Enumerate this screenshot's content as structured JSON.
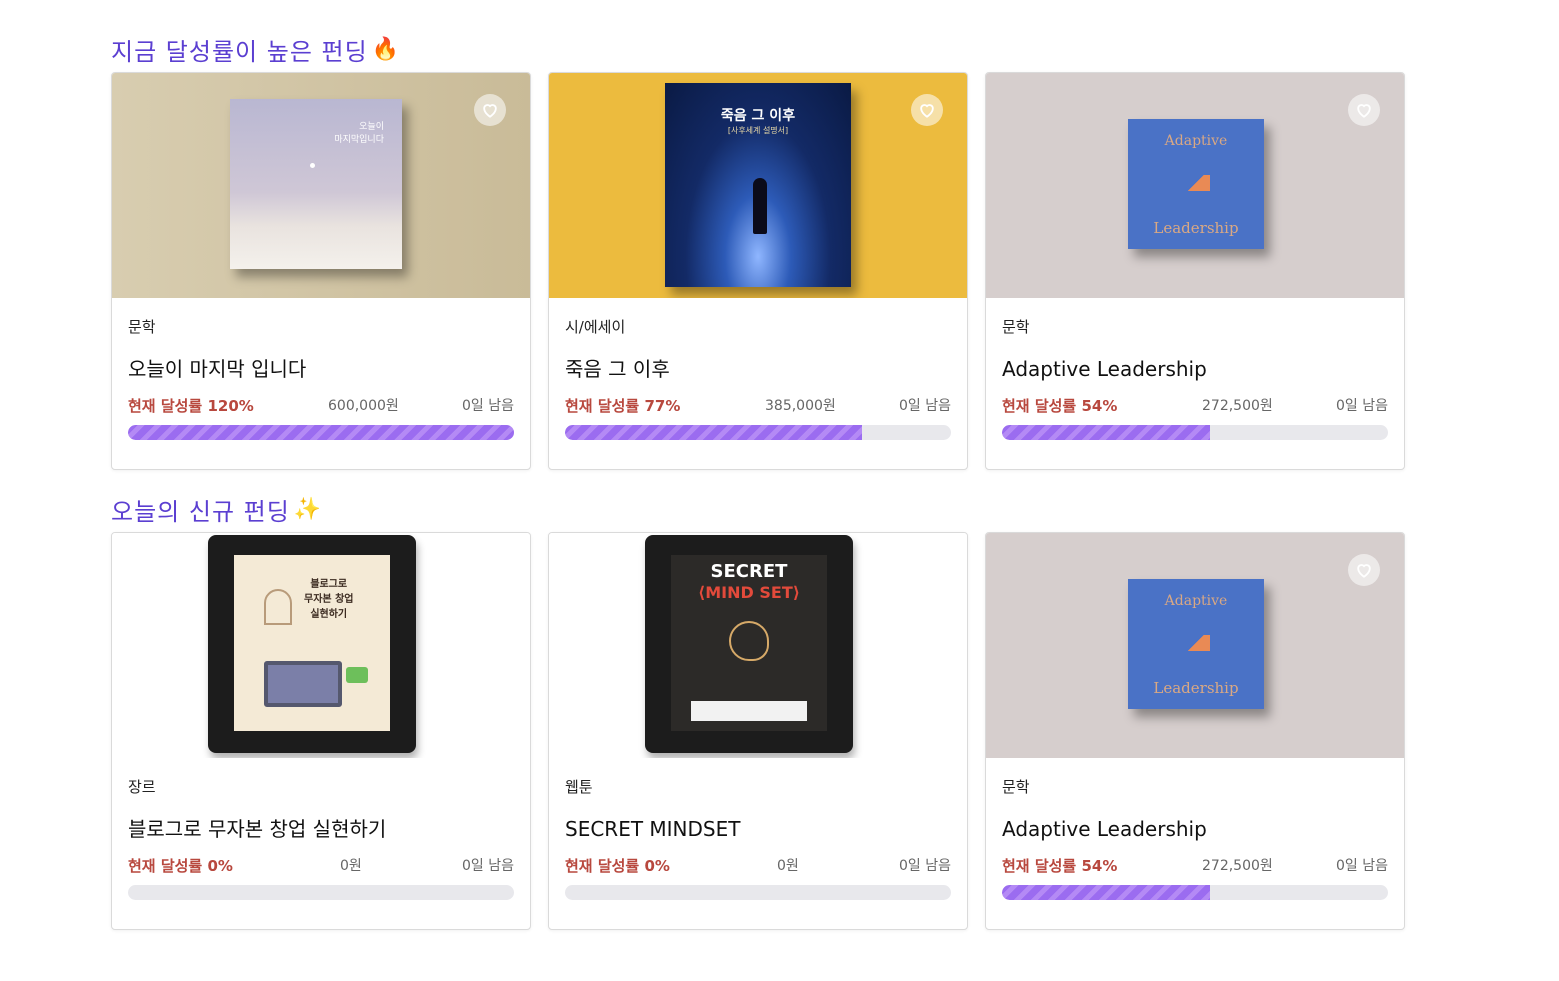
{
  "sections": [
    {
      "title": "지금 달성률이 높은 펀딩",
      "emoji": "🔥"
    },
    {
      "title": "오늘의 신규 펀딩",
      "emoji": "✨"
    }
  ],
  "cards": [
    {
      "category": "문학",
      "title": "오늘이 마지막 입니다",
      "rate": "현재 달성률 120%",
      "amount": "600,000원",
      "days": "0일 남음",
      "progress": 1.0,
      "cover": {
        "bg": "#cfc2a2",
        "book_bg": "#c6c3d6",
        "book_title": "오늘이\n마지막입니다"
      }
    },
    {
      "category": "시/에세이",
      "title": "죽음 그 이후",
      "rate": "현재 달성률 77%",
      "amount": "385,000원",
      "days": "0일 남음",
      "progress": 0.77,
      "cover": {
        "bg": "#ecbb3e",
        "book_bg": "#142a5e",
        "book_title": "죽음 그 이후",
        "book_subtitle": "[사후세계 설명서]"
      }
    },
    {
      "category": "문학",
      "title": "Adaptive Leadership",
      "rate": "현재 달성률 54%",
      "amount": "272,500원",
      "days": "0일 남음",
      "progress": 0.54,
      "cover": {
        "bg": "#d6cecd",
        "book_bg": "#4a72c6",
        "book_title_top": "Adaptive",
        "book_title_bottom": "Leadership"
      }
    },
    {
      "category": "장르",
      "title": "블로그로 무자본 창업 실현하기",
      "rate": "현재 달성률 0%",
      "amount": "0원",
      "days": "0일 남음",
      "progress": 0,
      "cover": {
        "bg": "#ffffff",
        "screen_bg": "#f4ead6",
        "screen_title": "블로그로\n무자본 창업\n실현하기"
      }
    },
    {
      "category": "웹툰",
      "title": "SECRET MINDSET",
      "rate": "현재 달성률 0%",
      "amount": "0원",
      "days": "0일 남음",
      "progress": 0,
      "cover": {
        "bg": "#ffffff",
        "screen_bg": "#2c2a28",
        "screen_title_top": "SECRET",
        "screen_title_bottom": "⟨MIND SET⟩"
      }
    },
    {
      "category": "문학",
      "title": "Adaptive Leadership",
      "rate": "현재 달성률 54%",
      "amount": "272,500원",
      "days": "0일 남음",
      "progress": 0.54,
      "cover": {
        "bg": "#d6cecd",
        "book_bg": "#4a72c6",
        "book_title_top": "Adaptive",
        "book_title_bottom": "Leadership"
      }
    }
  ]
}
